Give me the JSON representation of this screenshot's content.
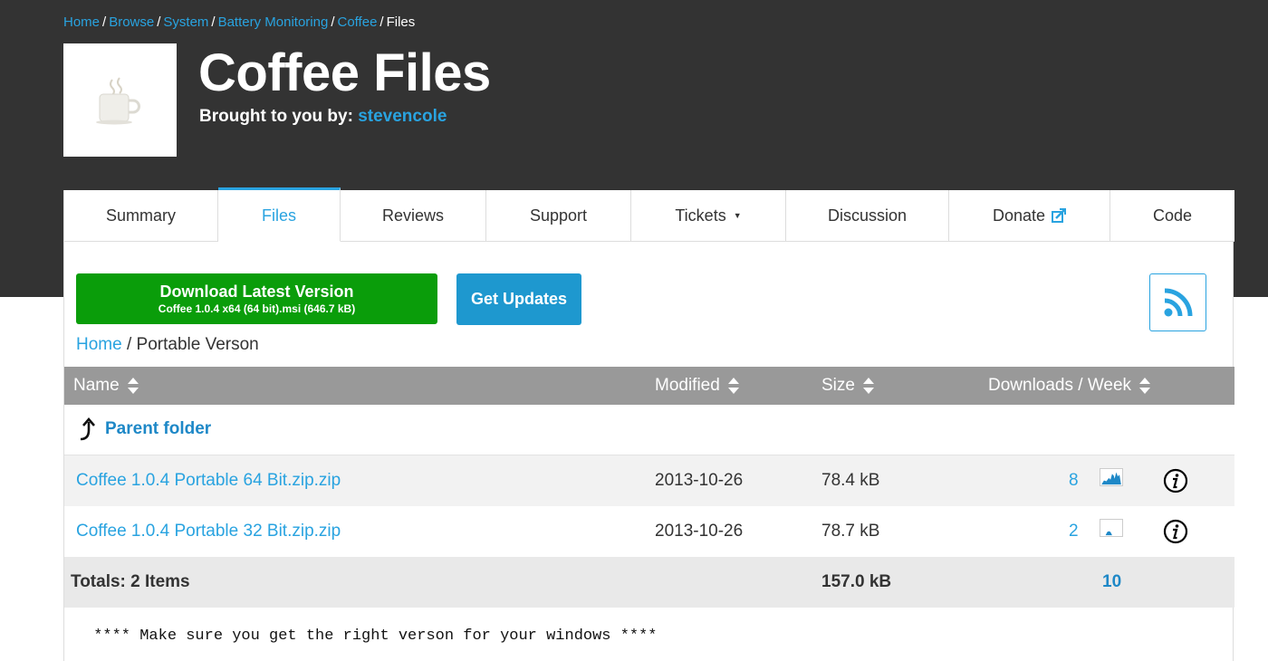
{
  "breadcrumb": {
    "items": [
      "Home",
      "Browse",
      "System",
      "Battery Monitoring",
      "Coffee"
    ],
    "current": "Files",
    "separator": "/"
  },
  "project": {
    "title": "Coffee Files",
    "brought_label": "Brought to you by:",
    "author": "stevencole",
    "logo_icon": "coffee-cup-icon"
  },
  "tabs": [
    {
      "label": "Summary",
      "active": false
    },
    {
      "label": "Files",
      "active": true
    },
    {
      "label": "Reviews",
      "active": false
    },
    {
      "label": "Support",
      "active": false
    },
    {
      "label": "Tickets",
      "active": false,
      "caret": "▼"
    },
    {
      "label": "Discussion",
      "active": false
    },
    {
      "label": "Donate",
      "active": false,
      "icon": "external-edit-icon"
    },
    {
      "label": "Code",
      "active": false
    }
  ],
  "actions": {
    "download_main": "Download Latest Version",
    "download_sub": "Coffee 1.0.4 x64 (64 bit).msi (646.7 kB)",
    "updates": "Get Updates",
    "rss_icon": "rss-icon"
  },
  "path": {
    "home": "Home",
    "separator": "/",
    "current": "Portable Verson"
  },
  "table": {
    "headers": {
      "name": "Name",
      "modified": "Modified",
      "size": "Size",
      "downloads": "Downloads / Week"
    },
    "parent_folder": "Parent folder",
    "rows": [
      {
        "name": "Coffee 1.0.4 Portable 64 Bit.zip.zip",
        "modified": "2013-10-26",
        "size": "78.4 kB",
        "downloads": "8"
      },
      {
        "name": "Coffee 1.0.4 Portable 32 Bit.zip.zip",
        "modified": "2013-10-26",
        "size": "78.7 kB",
        "downloads": "2"
      }
    ],
    "totals": {
      "label": "Totals: 2 Items",
      "size": "157.0 kB",
      "downloads": "10"
    }
  },
  "readme": " **** Make sure you get the right verson for your windows ****",
  "colors": {
    "header_bg": "#333333",
    "link": "#29a3e0",
    "download_green": "#0a9d0a",
    "updates_blue": "#1e98cf",
    "table_header": "#999999"
  }
}
